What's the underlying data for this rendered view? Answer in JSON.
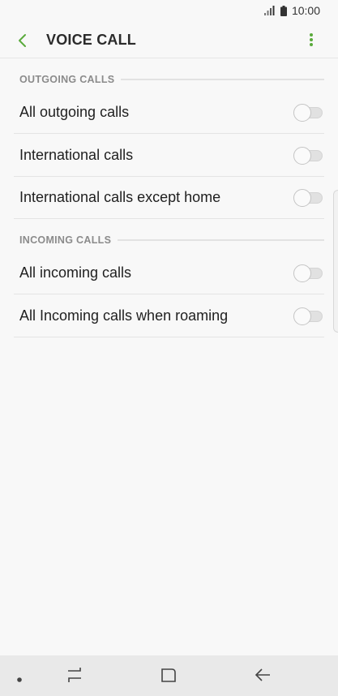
{
  "status_bar": {
    "time": "10:00",
    "signal_icon": "signal-icon",
    "battery_icon": "battery-icon"
  },
  "app_bar": {
    "title": "VOICE CALL",
    "back_icon": "back-arrow-icon",
    "more_icon": "more-vert-icon",
    "accent_color": "#5aaa3c"
  },
  "sections": [
    {
      "header": "OUTGOING CALLS",
      "items": [
        {
          "label": "All outgoing calls",
          "enabled": false
        },
        {
          "label": "International calls",
          "enabled": false
        },
        {
          "label": "International calls except home",
          "enabled": false
        }
      ]
    },
    {
      "header": "INCOMING CALLS",
      "items": [
        {
          "label": "All incoming calls",
          "enabled": false
        },
        {
          "label": "All Incoming calls when roaming",
          "enabled": false
        }
      ]
    }
  ],
  "nav_bar": {
    "buttons": [
      "dot-icon",
      "recents-icon",
      "home-icon",
      "back-icon"
    ]
  }
}
